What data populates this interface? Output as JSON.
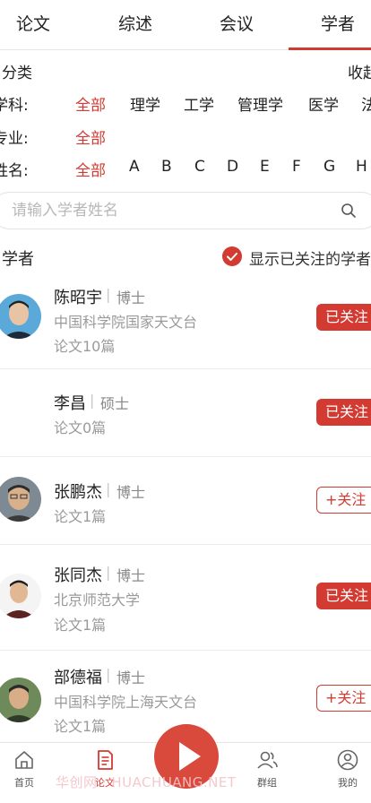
{
  "tabs": [
    {
      "label": "论文"
    },
    {
      "label": "综述"
    },
    {
      "label": "会议"
    },
    {
      "label": "学者"
    }
  ],
  "filter": {
    "title": "分类",
    "collapse": "收起",
    "subject": {
      "label": "学科:",
      "options": [
        "全部",
        "理学",
        "工学",
        "管理学",
        "医学",
        "法"
      ]
    },
    "major": {
      "label": "专业:",
      "options": [
        "全部"
      ]
    },
    "name": {
      "label": "姓名:",
      "options": [
        "全部",
        "A",
        "B",
        "C",
        "D",
        "E",
        "F",
        "G",
        "H"
      ]
    }
  },
  "search": {
    "placeholder": "请输入学者姓名",
    "value": ""
  },
  "list_header": {
    "title": "学者",
    "toggle_label": "显示已关注的学者"
  },
  "scholars": [
    {
      "name": "陈昭宇",
      "degree": "博士",
      "org": "中国科学院国家天文台",
      "papers": "论文10篇",
      "follow": "已关注"
    },
    {
      "name": "李昌",
      "degree": "硕士",
      "org": "",
      "papers": "论文0篇",
      "follow": "已关注"
    },
    {
      "name": "张鹏杰",
      "degree": "博士",
      "org": "",
      "papers": "论文1篇",
      "follow": "+关注"
    },
    {
      "name": "张同杰",
      "degree": "博士",
      "org": "北京师范大学",
      "papers": "论文1篇",
      "follow": "已关注"
    },
    {
      "name": "部德福",
      "degree": "博士",
      "org": "中国科学院上海天文台",
      "papers": "论文1篇",
      "follow": "+关注"
    }
  ],
  "bottom_nav": [
    {
      "label": "首页",
      "icon": "home-icon"
    },
    {
      "label": "论文",
      "icon": "document-icon"
    },
    {
      "label": "",
      "icon": "play-icon"
    },
    {
      "label": "群组",
      "icon": "group-icon"
    },
    {
      "label": "我的",
      "icon": "profile-icon"
    }
  ],
  "watermark": "华创网 · HUACHUANG.NET",
  "colors": {
    "accent": "#d33a32",
    "muted": "#9a9a9a",
    "divider": "#ececec"
  }
}
